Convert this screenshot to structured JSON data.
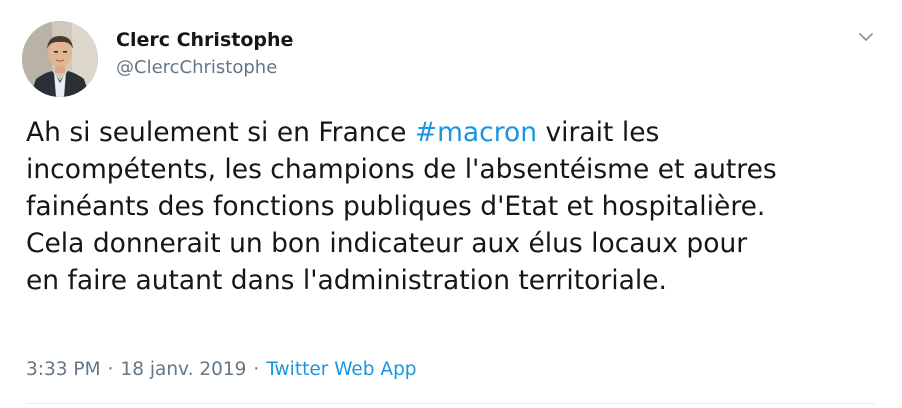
{
  "author": {
    "display_name": "Clerc Christophe",
    "handle": "@ClercChristophe"
  },
  "tweet": {
    "lines": [
      {
        "before": "Ah si seulement si en France ",
        "hashtag": "#macron",
        "after": " virait les"
      },
      {
        "text": "incompétents, les champions de l'absentéisme et autres"
      },
      {
        "text": "fainéants des fonctions publiques d'Etat et hospitalière."
      },
      {
        "text": "Cela donnerait un bon indicateur aux élus locaux pour"
      },
      {
        "text": "en faire autant dans l'administration territoriale."
      }
    ]
  },
  "meta": {
    "time": "3:33 PM",
    "separator": "·",
    "date": "18 janv. 2019",
    "source": "Twitter Web App"
  },
  "icons": {
    "caret": "chevron-down-icon",
    "avatar": "avatar"
  },
  "colors": {
    "link": "#1b95e0",
    "secondary_text": "#657786",
    "primary_text": "#14171a"
  }
}
